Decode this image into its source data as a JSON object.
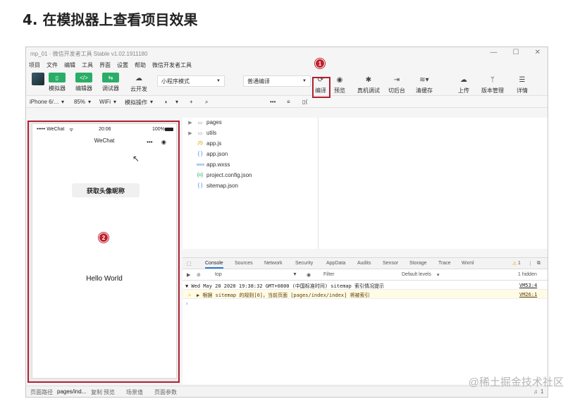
{
  "heading": "4. 在模拟器上查看项目效果",
  "window": {
    "title": "mp_01 · 微信开发者工具 Stable v1.02.1911180",
    "controls": [
      "—",
      "☐",
      "✕"
    ],
    "menu": [
      "项目",
      "文件",
      "编辑",
      "工具",
      "界面",
      "设置",
      "帮助",
      "微信开发者工具"
    ]
  },
  "toolbar": {
    "simulator": "模拟器",
    "editor": "编辑器",
    "debugger": "调试器",
    "cloud": "云开发",
    "mode_select": "小程序模式",
    "compile_select": "普通编译",
    "compile": "编译",
    "preview": "预览",
    "remote_debug": "真机调试",
    "background": "切后台",
    "clear_cache": "清缓存",
    "upload": "上传",
    "version": "版本管理",
    "details": "详情"
  },
  "subbar": {
    "device": "iPhone 6/…",
    "zoom": "85%",
    "network": "WiFi",
    "simulate": "模拟操作"
  },
  "phone": {
    "carrier": "••••• WeChat",
    "time": "20:06",
    "battery": "100%",
    "nav_title": "WeChat",
    "get_button": "获取头像昵称",
    "hello": "Hello World"
  },
  "files": [
    {
      "icon": "folder",
      "name": "pages"
    },
    {
      "icon": "folder",
      "name": "utils"
    },
    {
      "icon": "JS",
      "name": "app.js"
    },
    {
      "icon": "{ }",
      "name": "app.json"
    },
    {
      "icon": "wxss",
      "name": "app.wxss"
    },
    {
      "icon": "{o}",
      "name": "project.config.json"
    },
    {
      "icon": "{ }",
      "name": "sitemap.json"
    }
  ],
  "devtools": {
    "tabs": [
      "Console",
      "Sources",
      "Network",
      "Security",
      "AppData",
      "Audits",
      "Sensor",
      "Storage",
      "Trace",
      "Wxml"
    ],
    "warn_count": "1",
    "context": "top",
    "filter_placeholder": "Filter",
    "levels": "Default levels",
    "hidden": "1 hidden",
    "log1": "▼ Wed May 20 2020 19:38:32 GMT+0800 (中国标准时间) sitemap 索引情况提示",
    "log1_src": "VM53:4",
    "log2": "▶ 根据 sitemap 的规则[0]，当前页面 [pages/index/index] 将被索引",
    "log2_src": "VM26:1",
    "prompt": "›"
  },
  "footer": {
    "path_label": "页面路径",
    "path_value": "pages/ind...",
    "copy": "复制",
    "preview": "预览",
    "scene": "场景值",
    "params": "页面参数",
    "notif": "1"
  },
  "badges": {
    "one": "1",
    "two": "2"
  },
  "watermark": "@稀土掘金技术社区",
  "colors": {
    "green": "#2aae67",
    "annotation_red": "#b22030"
  }
}
